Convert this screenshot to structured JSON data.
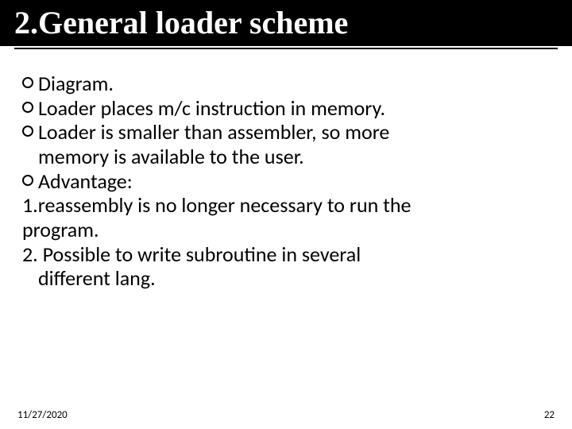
{
  "title": "2.General loader scheme",
  "bullets": {
    "b1": "Diagram.",
    "b2": "Loader places m/c instruction in memory.",
    "b3": "Loader is smaller than assembler, so more",
    "b3c": "memory is available to the user.",
    "b4": "Advantage:",
    "l1a": "1.reassembly is no longer necessary to run the",
    "l1b": "program.",
    "l2a": "2. Possible to write subroutine in several",
    "l2b": "different lang."
  },
  "footer": {
    "date": "11/27/2020",
    "page": "22"
  }
}
